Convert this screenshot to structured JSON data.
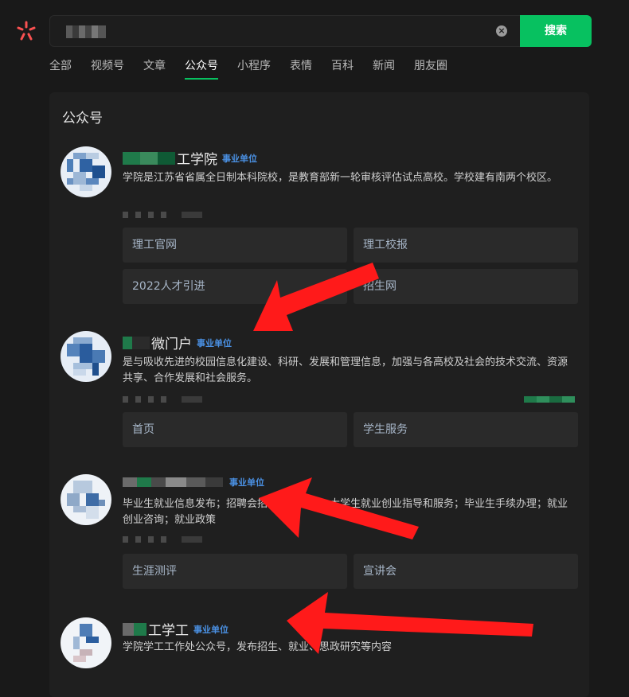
{
  "search": {
    "button_label": "搜索",
    "clear_glyph": "×"
  },
  "tabs": [
    {
      "label": "全部"
    },
    {
      "label": "视频号"
    },
    {
      "label": "文章"
    },
    {
      "label": "公众号"
    },
    {
      "label": "小程序"
    },
    {
      "label": "表情"
    },
    {
      "label": "百科"
    },
    {
      "label": "新闻"
    },
    {
      "label": "朋友圈"
    }
  ],
  "active_tab": "公众号",
  "panel": {
    "title": "公众号"
  },
  "accounts": [
    {
      "name": "工学院",
      "badge": "事业单位",
      "description": "学院是江苏省省属全日制本科院校，是教育部新一轮审核评估试点高校。学校建有南两个校区。",
      "links": [
        "理工官网",
        "理工校报",
        "2022人才引进",
        "招生网"
      ]
    },
    {
      "name": "微门户",
      "badge": "事业单位",
      "description": "是与吸收先进的校园信息化建设、科研、发展和管理信息，加强与各高校及社会的技术交流、资源共享、合作发展和社会服务。",
      "links": [
        "首页",
        "学生服务"
      ]
    },
    {
      "name": "",
      "badge": "事业单位",
      "description": "毕业生就业信息发布；招聘会招聘活动发布；大学生就业创业指导和服务；毕业生手续办理；就业创业咨询；就业政策",
      "links": [
        "生涯测评",
        "宣讲会"
      ]
    },
    {
      "name": "工学工",
      "badge": "事业单位",
      "description": "学院学工工作处公众号，发布招生、就业、思政研究等内容",
      "links": []
    }
  ],
  "colors": {
    "accent": "#07c160",
    "badge": "#4a90e2",
    "arrow": "#ff1a1a",
    "logo": "#fa5151"
  }
}
